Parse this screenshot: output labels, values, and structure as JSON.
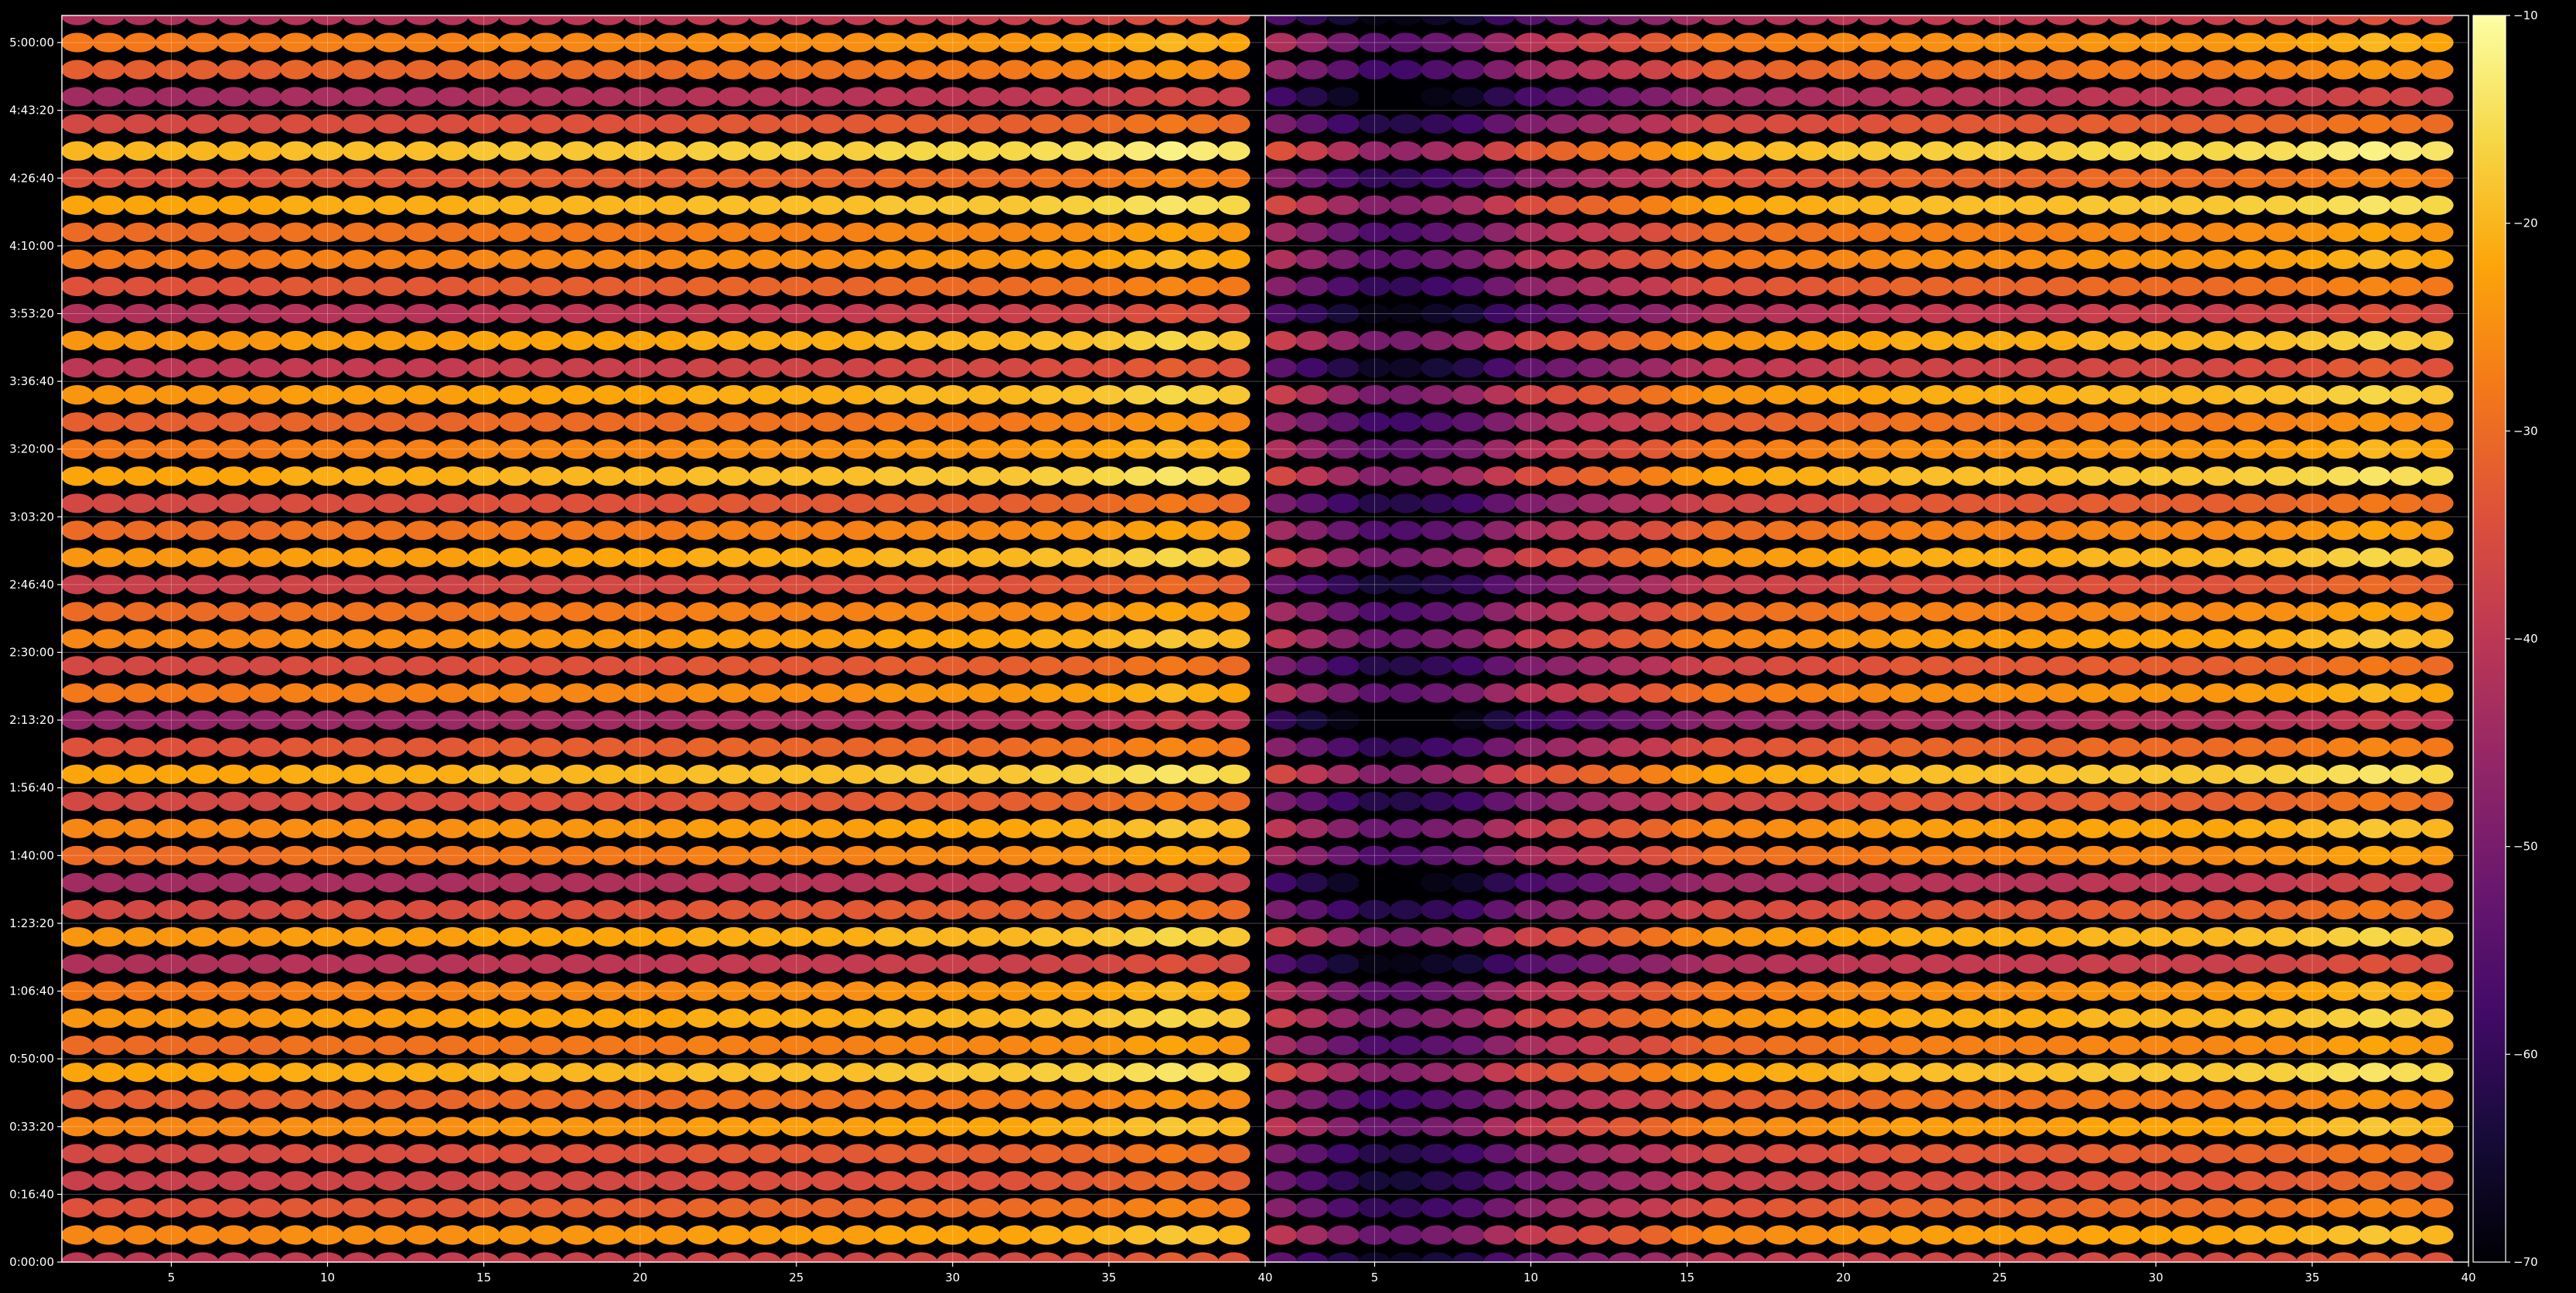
{
  "chart_data": {
    "type": "heatmap",
    "title": "",
    "xlabel": "",
    "ylabel": "",
    "colormap": "inferno",
    "background": "#000000",
    "grid": true,
    "color_range": [
      -70,
      -10
    ],
    "colorbar": {
      "position": "right",
      "ticks": [
        -70,
        -60,
        -50,
        -40,
        -30,
        -20,
        -10
      ],
      "tick_labels": [
        "−70",
        "−60",
        "−50",
        "−40",
        "−30",
        "−20",
        "−10"
      ]
    },
    "x_range": [
      1.5,
      40
    ],
    "x_ticks": [
      5,
      10,
      15,
      20,
      25,
      30,
      35,
      40
    ],
    "x_tick_labels": [
      "5",
      "10",
      "15",
      "20",
      "25",
      "30",
      "35",
      "40"
    ],
    "y_range_seconds": [
      0,
      18400
    ],
    "y_ticks_seconds": [
      0,
      1000,
      2000,
      3000,
      4000,
      5000,
      6000,
      7000,
      8000,
      9000,
      10000,
      11000,
      12000,
      13000,
      14000,
      15000,
      16000,
      17000,
      18000
    ],
    "y_tick_labels": [
      "0:00:00",
      "0:16:40",
      "0:33:20",
      "0:50:00",
      "1:06:40",
      "1:23:20",
      "1:40:00",
      "1:56:40",
      "2:13:20",
      "2:30:00",
      "2:46:40",
      "3:03:20",
      "3:20:00",
      "3:36:40",
      "3:53:20",
      "4:10:00",
      "4:26:40",
      "4:43:20",
      "5:00:00"
    ],
    "x_columns": [
      2,
      3,
      4,
      5,
      6,
      7,
      8,
      9,
      10,
      11,
      12,
      13,
      14,
      15,
      16,
      17,
      18,
      19,
      20,
      21,
      22,
      23,
      24,
      25,
      26,
      27,
      28,
      29,
      30,
      31,
      32,
      33,
      34,
      35,
      36,
      37,
      38,
      39
    ],
    "row_times_seconds": [
      0,
      400,
      800,
      1200,
      1600,
      2000,
      2400,
      2800,
      3200,
      3600,
      4000,
      4400,
      4800,
      5200,
      5600,
      6000,
      6400,
      6800,
      7200,
      7600,
      8000,
      8400,
      8800,
      9200,
      9600,
      10000,
      10400,
      10800,
      11200,
      11600,
      12000,
      12400,
      12800,
      13200,
      13600,
      14000,
      14400,
      14800,
      15200,
      15600,
      16000,
      16400,
      16800,
      17200,
      17600,
      18000,
      18400
    ],
    "row_levels_dB": [
      -40,
      -26,
      -34,
      -38,
      -36,
      -26,
      -32,
      -22,
      -30,
      -24,
      -28,
      -42,
      -24,
      -36,
      -44,
      -30,
      -26,
      -36,
      -22,
      -34,
      -46,
      -28,
      -36,
      -26,
      -30,
      -38,
      -24,
      -30,
      -36,
      -22,
      -28,
      -32,
      -24,
      -40,
      -24,
      -42,
      -34,
      -28,
      -30,
      -22,
      -34,
      -20,
      -36,
      -44,
      -32,
      -28,
      -42
    ],
    "column_gain_dB": [
      0,
      0,
      0,
      0,
      0,
      0,
      0,
      1,
      1,
      1,
      1,
      1,
      1,
      2,
      2,
      2,
      2,
      2,
      2,
      2,
      3,
      3,
      3,
      3,
      3,
      3,
      4,
      4,
      4,
      4,
      4,
      5,
      5,
      6,
      7,
      8,
      7,
      6
    ],
    "right_panel_column_offset_dB": [
      -14,
      -18,
      -22,
      -26,
      -26,
      -24,
      -22,
      -18,
      -14,
      -12,
      -10,
      -8,
      -6,
      -4,
      -2,
      -2,
      -1,
      -1,
      0,
      0,
      0,
      0,
      0,
      0,
      0,
      0,
      0,
      0,
      0,
      0,
      0,
      0,
      0,
      0,
      0,
      0,
      0,
      0
    ],
    "panels": [
      {
        "name": "left"
      },
      {
        "name": "right"
      }
    ]
  }
}
